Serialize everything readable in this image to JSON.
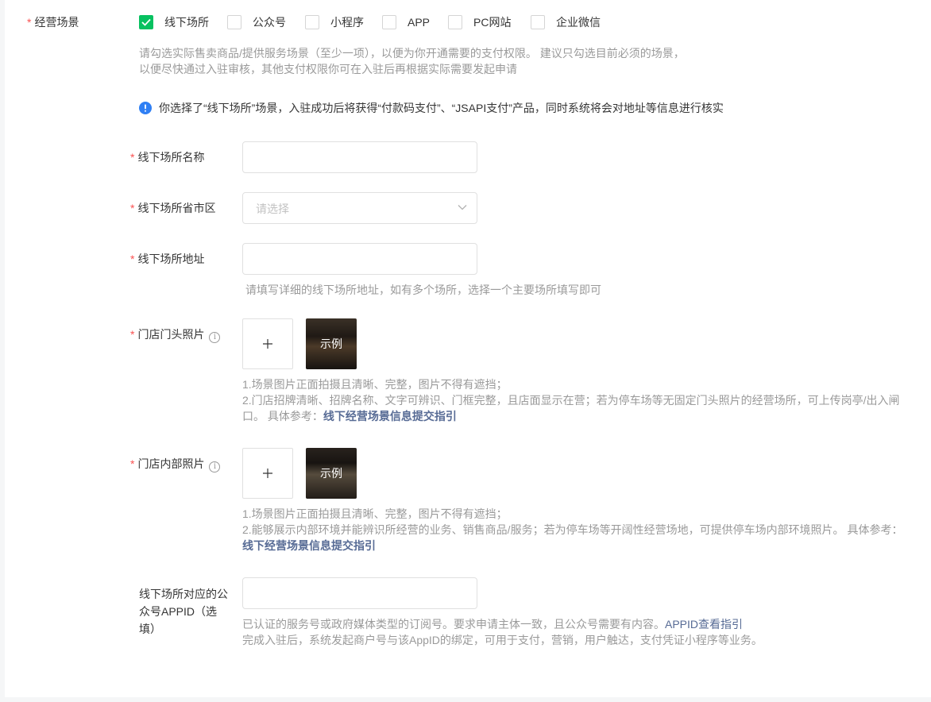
{
  "scenes": {
    "label": "经营场景",
    "options": [
      {
        "label": "线下场所",
        "checked": true
      },
      {
        "label": "公众号",
        "checked": false
      },
      {
        "label": "小程序",
        "checked": false
      },
      {
        "label": "APP",
        "checked": false
      },
      {
        "label": "PC网站",
        "checked": false
      },
      {
        "label": "企业微信",
        "checked": false
      }
    ],
    "hint_line1": "请勾选实际售卖商品/提供服务场景（至少一项），以便为你开通需要的支付权限。 建议只勾选目前必须的场景，",
    "hint_line2": "以便尽快通过入驻审核，其他支付权限你可在入驻后再根据实际需要发起申请",
    "notice": "你选择了“线下场所”场景，入驻成功后将获得“付款码支付”、“JSAPI支付”产品，同时系统将会对地址等信息进行核实"
  },
  "venue_name": {
    "label": "线下场所名称",
    "value": ""
  },
  "venue_region": {
    "label": "线下场所省市区",
    "placeholder": "请选择"
  },
  "venue_address": {
    "label": "线下场所地址",
    "value": "",
    "hint": "请填写详细的线下场所地址，如有多个场所，选择一个主要场所填写即可"
  },
  "storefront_photo": {
    "label": "门店门头照片",
    "upload_icon": "plus-icon",
    "example_label": "示例",
    "hint_line1": "1.场景图片正面拍摄且清晰、完整，图片不得有遮挡；",
    "hint_line2": "2.门店招牌清晰、招牌名称、文字可辨识、门框完整，且店面显示在营；若为停车场等无固定门头照片的经营场所，可上传岗亭/出入闸",
    "hint_line3": "口。 具体参考：",
    "guide_link": "线下经营场景信息提交指引"
  },
  "interior_photo": {
    "label": "门店内部照片",
    "upload_icon": "plus-icon",
    "example_label": "示例",
    "hint_line1": "1.场景图片正面拍摄且清晰、完整，图片不得有遮挡；",
    "hint_line2": "2.能够展示内部环境并能辨识所经营的业务、销售商品/服务；若为停车场等开阔性经营场地，可提供停车场内部环境照片。 具体参考：",
    "guide_link": "线下经营场景信息提交指引"
  },
  "appid": {
    "label_line1": "线下场所对应的公",
    "label_line2": "众号APPID（选",
    "label_line3": "填）",
    "value": "",
    "hint_line1": "已认证的服务号或政府媒体类型的订阅号。要求申请主体一致，且公众号需要有内容。",
    "hint_link": "APPID查看指引",
    "hint_line2": "完成入驻后，系统发起商户号与该AppID的绑定，可用于支付，营销，用户触达，支付凭证小程序等业务。"
  },
  "colors": {
    "accent_green": "#07c160",
    "required_red": "#fa5151",
    "link_blue": "#576b95",
    "info_blue": "#2f7ff4"
  }
}
